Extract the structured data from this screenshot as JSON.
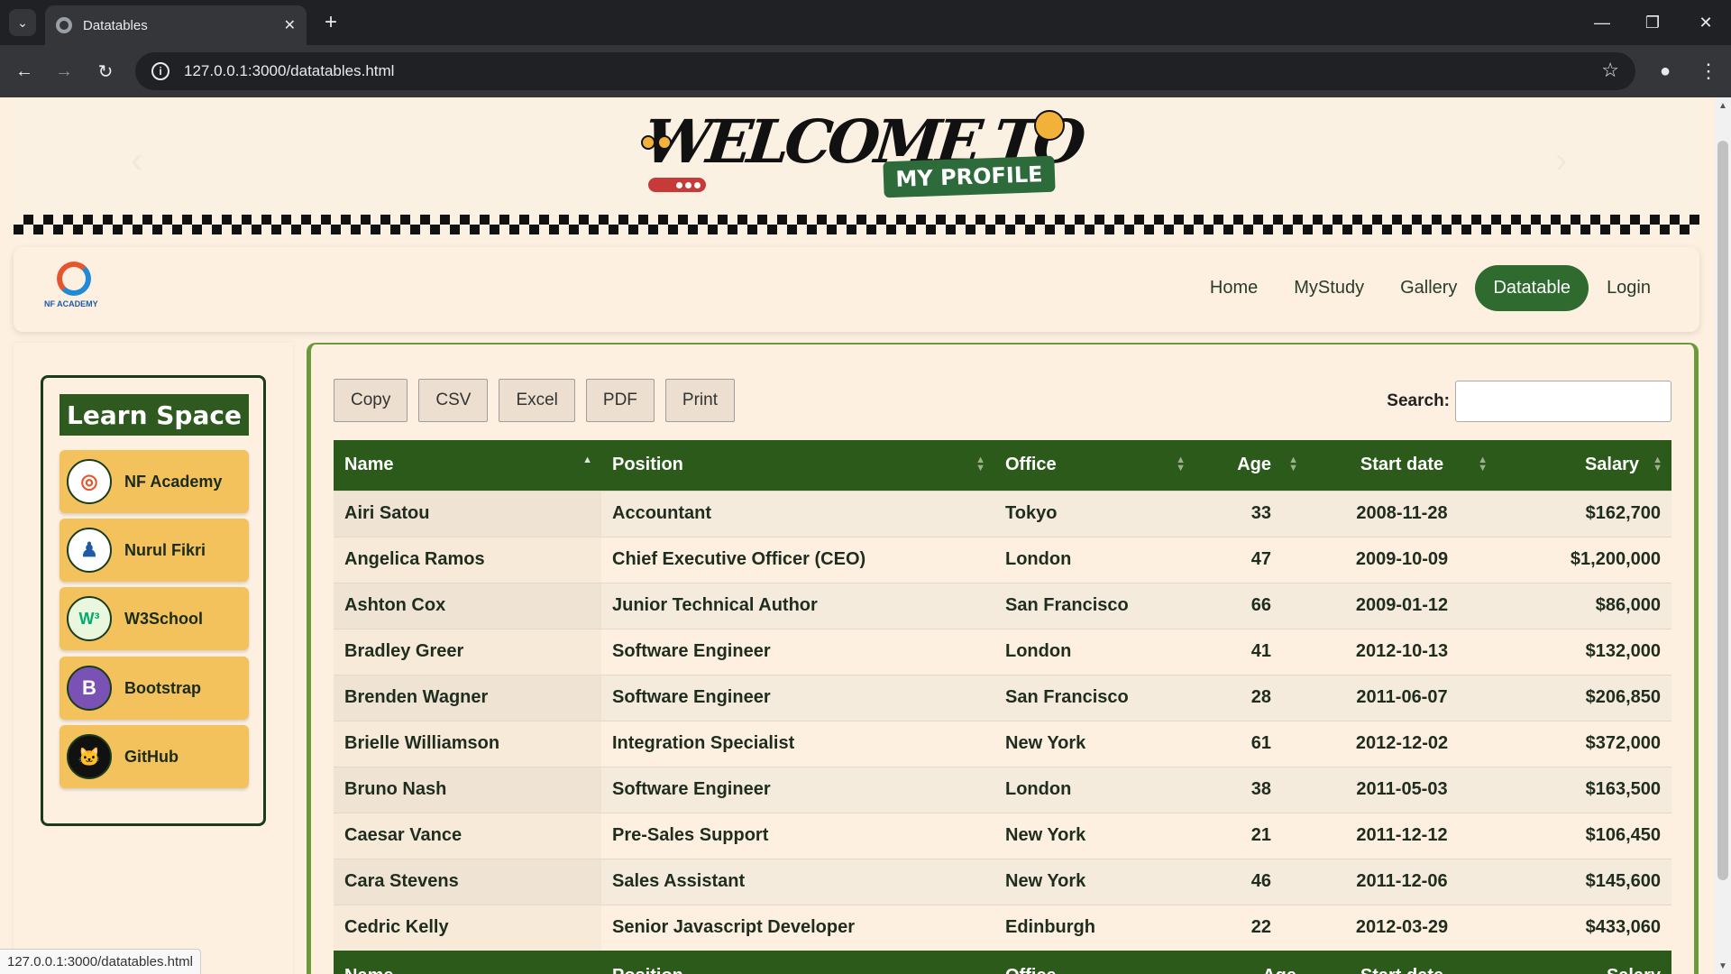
{
  "browser": {
    "tab_title": "Datatables",
    "url": "127.0.0.1:3000/datatables.html",
    "status_url": "127.0.0.1:3000/datatables.html"
  },
  "banner": {
    "headline": "WELCOME TO",
    "badge": "MY PROFILE"
  },
  "navbar": {
    "brand_text": "NF ACADEMY",
    "links": [
      {
        "label": "Home",
        "active": false
      },
      {
        "label": "MyStudy",
        "active": false
      },
      {
        "label": "Gallery",
        "active": false
      },
      {
        "label": "Datatable",
        "active": true
      },
      {
        "label": "Login",
        "active": false
      }
    ]
  },
  "sidebar": {
    "title": "Learn Space",
    "items": [
      {
        "label": "NF Academy",
        "icon": "nf-academy-logo-icon",
        "glyph": "◎"
      },
      {
        "label": "Nurul Fikri",
        "icon": "nurul-fikri-logo-icon",
        "glyph": "♟"
      },
      {
        "label": "W3School",
        "icon": "w3schools-logo-icon",
        "glyph": "W³"
      },
      {
        "label": "Bootstrap",
        "icon": "bootstrap-logo-icon",
        "glyph": "B"
      },
      {
        "label": "GitHub",
        "icon": "github-logo-icon",
        "glyph": "🐱"
      }
    ]
  },
  "datatable": {
    "buttons": [
      "Copy",
      "CSV",
      "Excel",
      "PDF",
      "Print"
    ],
    "search_label": "Search:",
    "search_value": "",
    "columns": [
      "Name",
      "Position",
      "Office",
      "Age",
      "Start date",
      "Salary"
    ],
    "rows": [
      [
        "Airi Satou",
        "Accountant",
        "Tokyo",
        "33",
        "2008-11-28",
        "$162,700"
      ],
      [
        "Angelica Ramos",
        "Chief Executive Officer (CEO)",
        "London",
        "47",
        "2009-10-09",
        "$1,200,000"
      ],
      [
        "Ashton Cox",
        "Junior Technical Author",
        "San Francisco",
        "66",
        "2009-01-12",
        "$86,000"
      ],
      [
        "Bradley Greer",
        "Software Engineer",
        "London",
        "41",
        "2012-10-13",
        "$132,000"
      ],
      [
        "Brenden Wagner",
        "Software Engineer",
        "San Francisco",
        "28",
        "2011-06-07",
        "$206,850"
      ],
      [
        "Brielle Williamson",
        "Integration Specialist",
        "New York",
        "61",
        "2012-12-02",
        "$372,000"
      ],
      [
        "Bruno Nash",
        "Software Engineer",
        "London",
        "38",
        "2011-05-03",
        "$163,500"
      ],
      [
        "Caesar Vance",
        "Pre-Sales Support",
        "New York",
        "21",
        "2011-12-12",
        "$106,450"
      ],
      [
        "Cara Stevens",
        "Sales Assistant",
        "New York",
        "46",
        "2011-12-06",
        "$145,600"
      ],
      [
        "Cedric Kelly",
        "Senior Javascript Developer",
        "Edinburgh",
        "22",
        "2012-03-29",
        "$433,060"
      ]
    ],
    "footer_columns": [
      "Name",
      "Position",
      "Office",
      "Age",
      "Start date",
      "Salary"
    ]
  },
  "colors": {
    "header_green": "#2b5a1b",
    "nav_active": "#2f6b2f",
    "learn_item": "#f3c25c",
    "page_bg": "#fdf0e1"
  }
}
